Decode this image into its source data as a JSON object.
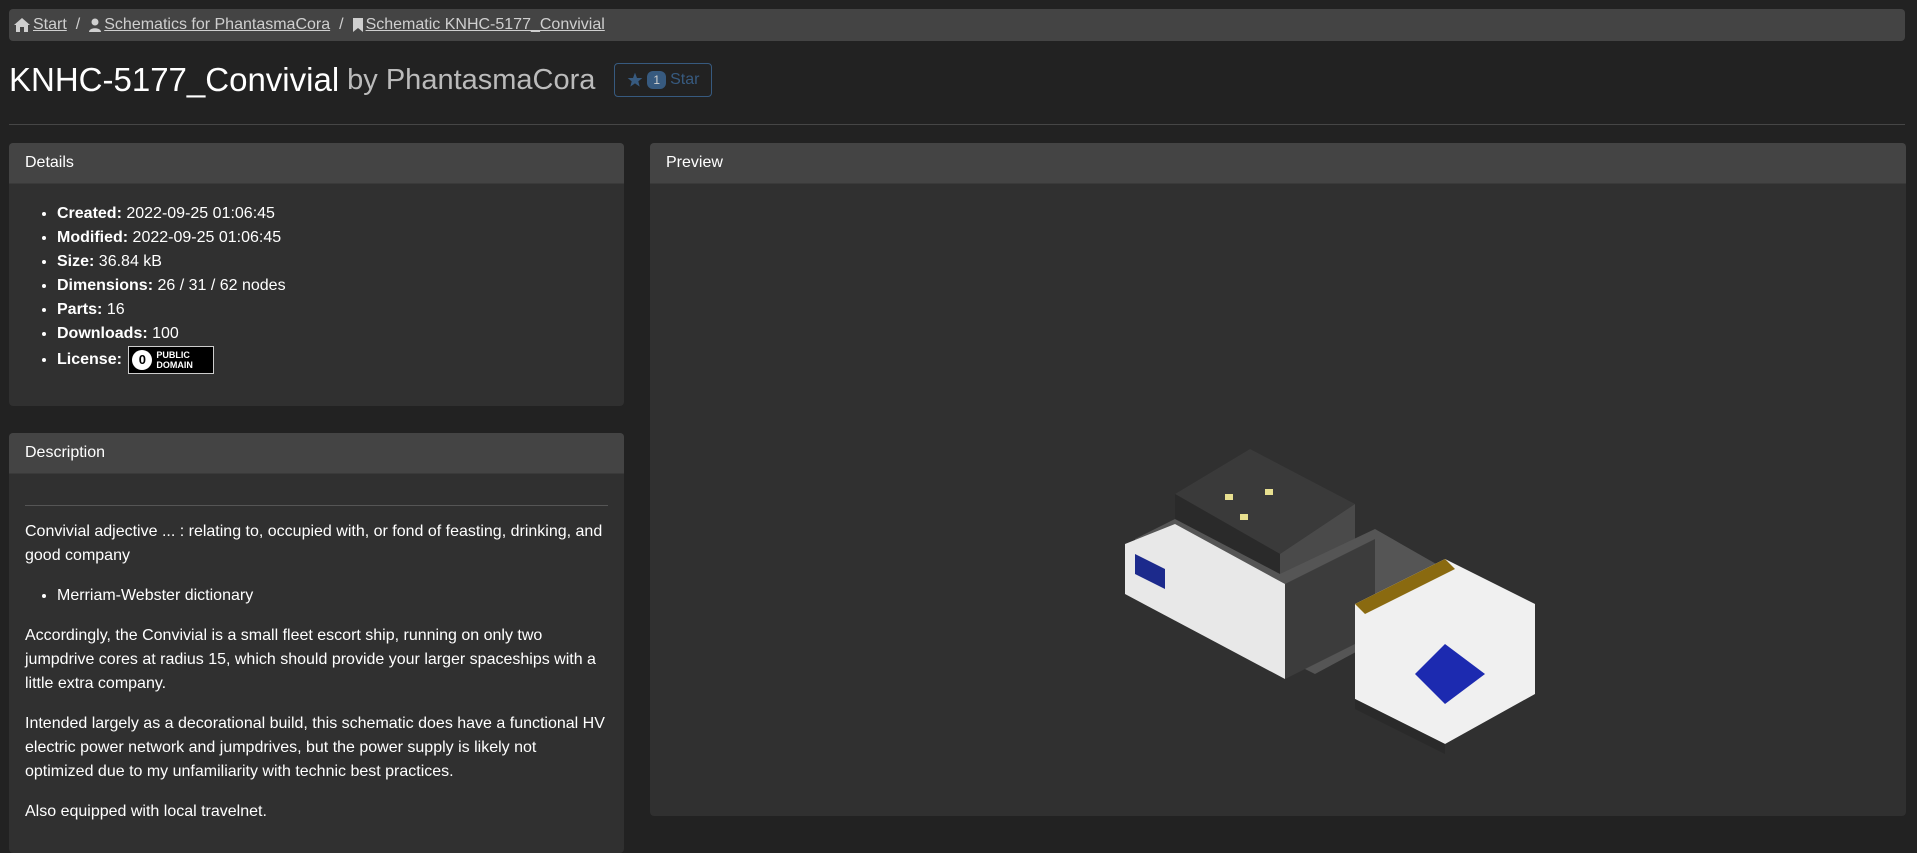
{
  "breadcrumb": {
    "items": [
      {
        "label": "Start",
        "icon": "home-icon"
      },
      {
        "label": "Schematics for PhantasmaCora",
        "icon": "user-icon"
      },
      {
        "label": "Schematic KNHC-5177_Convivial",
        "icon": "bookmark-icon"
      }
    ],
    "separator": "/"
  },
  "header": {
    "title": "KNHC-5177_Convivial",
    "by_text": "by PhantasmaCora",
    "star_count": "1",
    "star_label": "Star"
  },
  "details": {
    "title": "Details",
    "items": [
      {
        "label": "Created:",
        "value": "2022-09-25 01:06:45"
      },
      {
        "label": "Modified:",
        "value": "2022-09-25 01:06:45"
      },
      {
        "label": "Size:",
        "value": "36.84 kB"
      },
      {
        "label": "Dimensions:",
        "value": "26 / 31 / 62 nodes"
      },
      {
        "label": "Parts:",
        "value": "16"
      },
      {
        "label": "Downloads:",
        "value": "100"
      },
      {
        "label": "License:",
        "value": ""
      }
    ],
    "license_badge": {
      "symbol": "0",
      "line1": "PUBLIC",
      "line2": "DOMAIN"
    }
  },
  "description": {
    "title": "Description",
    "p1": "Convivial adjective ... : relating to, occupied with, or fond of feasting, drinking, and good company",
    "list_item": "Merriam-Webster dictionary",
    "p2": "Accordingly, the Convivial is a small fleet escort ship, running on only two jumpdrive cores at radius 15, which should provide your larger spaceships with a little extra company.",
    "p3": "Intended largely as a decorational build, this schematic does have a functional HV electric power network and jumpdrives, but the power supply is likely not optimized due to my unfamiliarity with technic best practices.",
    "p4": "Also equipped with local travelnet."
  },
  "preview": {
    "title": "Preview"
  },
  "colors": {
    "background": "#222222",
    "card": "#303030",
    "card_header": "#444444",
    "star_accent": "#375a7f"
  }
}
